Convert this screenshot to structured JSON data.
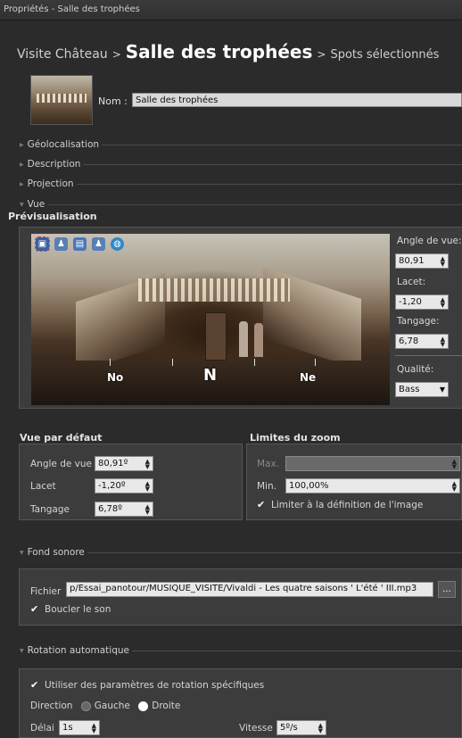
{
  "window": {
    "title": "Propriétés - Salle des trophées"
  },
  "breadcrumb": {
    "part1": "Visite Château",
    "sep1": ">",
    "current": "Salle des trophées",
    "sep2": ">",
    "part3": "Spots sélectionnés"
  },
  "nom": {
    "label": "Nom :",
    "value": "Salle des trophées"
  },
  "sections": {
    "geolocalisation": "Géolocalisation",
    "description": "Description",
    "projection": "Projection",
    "vue": "Vue"
  },
  "preview": {
    "title": "Prévisualisation",
    "toolbar_icons": [
      "hotspot-icon",
      "person-icon",
      "image-icon",
      "person2-icon",
      "globe-icon"
    ],
    "compass": {
      "left": "No",
      "center": "N",
      "right": "Ne"
    },
    "angle_label": "Angle de vue:",
    "angle_value": "80,91",
    "lacet_label": "Lacet:",
    "lacet_value": "-1,20",
    "tangage_label": "Tangage:",
    "tangage_value": "6,78",
    "qualite_label": "Qualité:",
    "qualite_value": "Bass"
  },
  "vue_defaut": {
    "title": "Vue par défaut",
    "angle_label": "Angle de vue",
    "angle_value": "80,91º",
    "lacet_label": "Lacet",
    "lacet_value": "-1,20º",
    "tangage_label": "Tangage",
    "tangage_value": "6,78º"
  },
  "zoom": {
    "title": "Limites du zoom",
    "max_label": "Max.",
    "max_value": "",
    "min_label": "Min.",
    "min_value": "100,00%",
    "limit_label": "Limiter à la définition de l'image"
  },
  "fond_sonore": {
    "title": "Fond sonore",
    "fichier_label": "Fichier",
    "fichier_value": "p/Essai_panotour/MUSIQUE_VISITE/Vivaldi - Les quatre saisons ' L'été ' III.mp3",
    "browse_label": "...",
    "boucler_label": "Boucler le son"
  },
  "rotation": {
    "title": "Rotation automatique",
    "specific_label": "Utiliser des paramètres de rotation spécifiques",
    "direction_label": "Direction",
    "gauche_label": "Gauche",
    "droite_label": "Droite",
    "delai_label": "Délai",
    "delai_value": "1s",
    "vitesse_label": "Vitesse",
    "vitesse_value": "5º/s"
  }
}
